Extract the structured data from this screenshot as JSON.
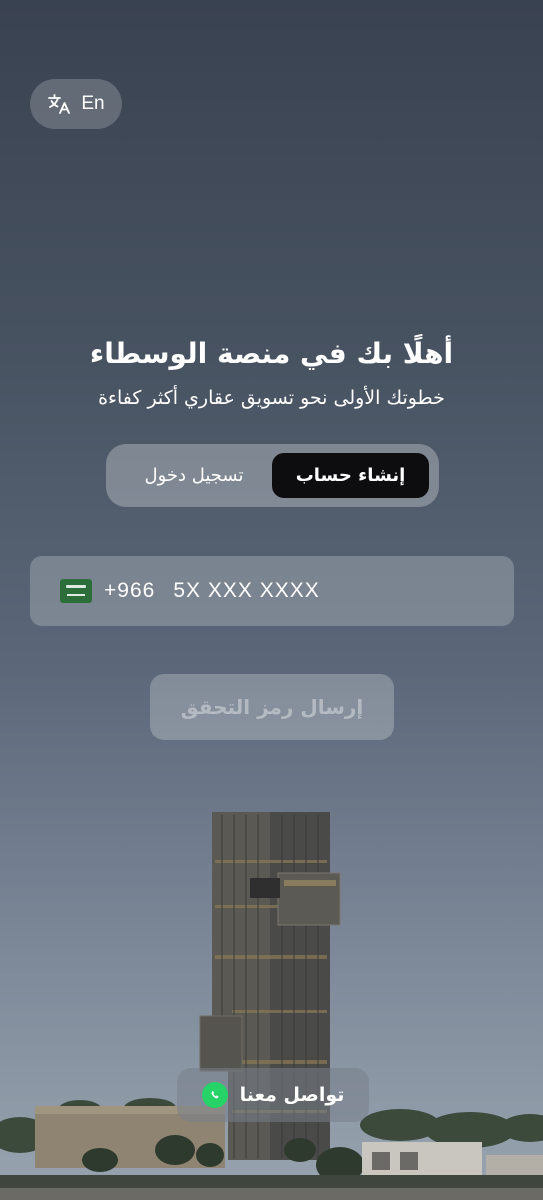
{
  "language_toggle": {
    "label": "En",
    "icon": "translate-icon"
  },
  "welcome": {
    "title": "أهلًا بك في منصة الوسطاء",
    "subtitle": "خطوتك الأولى نحو تسويق عقاري أكثر كفاءة"
  },
  "auth_tabs": {
    "signup_label": "إنشاء حساب",
    "login_label": "تسجيل دخول",
    "active": "signup"
  },
  "phone": {
    "country_flag": "saudi-arabia-flag-icon",
    "country_code": "+966",
    "placeholder": "5X XXX XXXX",
    "value": ""
  },
  "send_code_button": {
    "label": "إرسال رمز التحقق",
    "enabled": false
  },
  "contact_button": {
    "label": "تواصل معنا",
    "icon": "whatsapp-icon"
  },
  "colors": {
    "active_tab_bg": "#0d0d0f",
    "whatsapp_green": "#25d366",
    "flag_green": "#2c6e3a"
  }
}
